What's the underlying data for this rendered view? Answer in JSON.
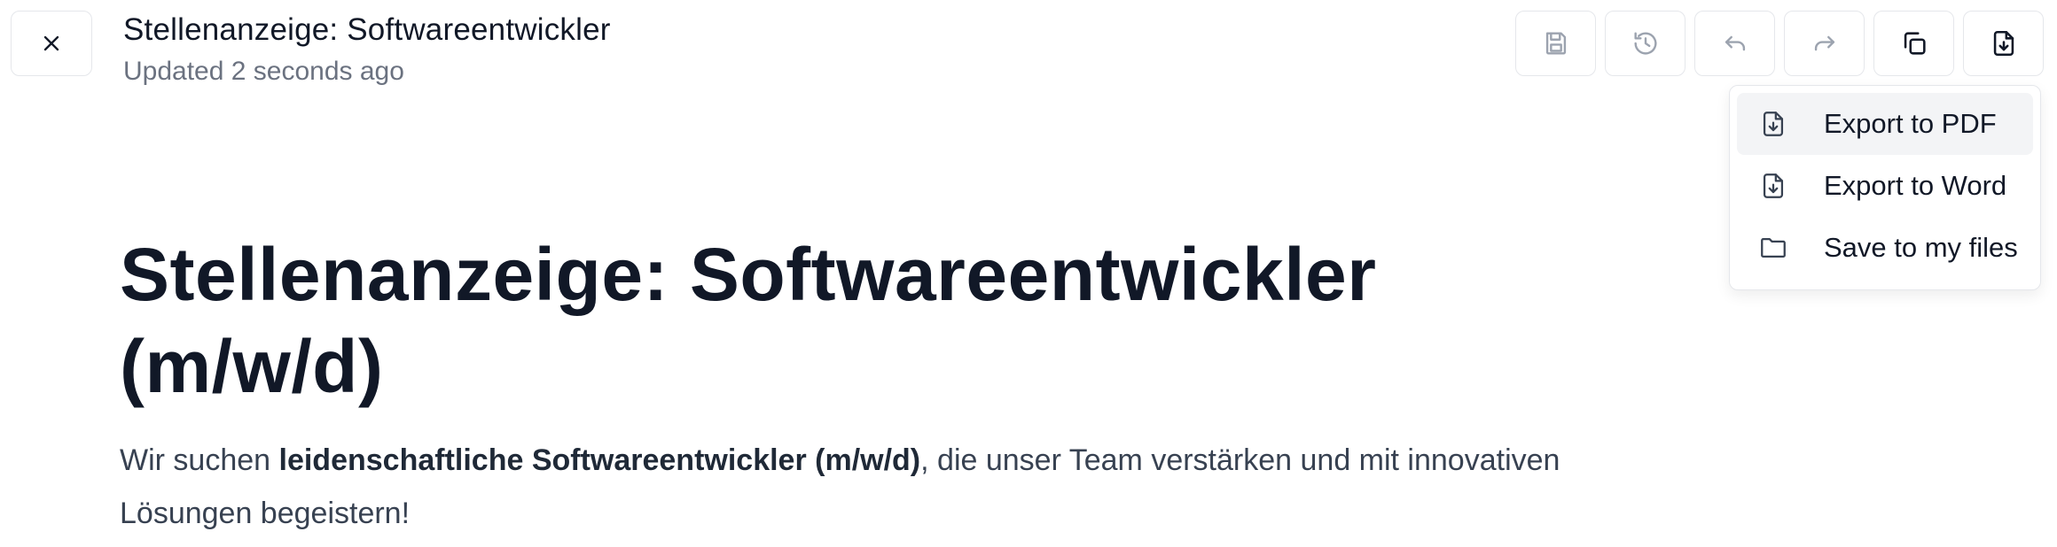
{
  "header": {
    "title": "Stellenanzeige: Softwareentwickler",
    "updated": "Updated 2 seconds ago"
  },
  "toolbar": {
    "buttons": [
      {
        "icon": "save-icon",
        "state": "disabled"
      },
      {
        "icon": "history-icon",
        "state": "disabled"
      },
      {
        "icon": "undo-icon",
        "state": "disabled"
      },
      {
        "icon": "redo-icon",
        "state": "disabled"
      },
      {
        "icon": "copy-icon",
        "state": "enabled"
      },
      {
        "icon": "export-icon",
        "state": "enabled"
      }
    ]
  },
  "export_menu": {
    "items": [
      {
        "label": "Export to PDF",
        "icon": "file-download-icon"
      },
      {
        "label": "Export to Word",
        "icon": "file-download-icon"
      },
      {
        "label": "Save to my files",
        "icon": "folder-icon"
      }
    ]
  },
  "document": {
    "heading": "Stellenanzeige: Softwareentwickler (m/w/d)",
    "paragraph": {
      "before": "Wir suchen ",
      "bold": "leidenschaftliche Softwareentwickler (m/w/d)",
      "after": ", die unser Team verstärken und mit innovativen Lösungen begeistern!"
    }
  },
  "colors": {
    "text_primary": "#111827",
    "text_muted": "#6b7280",
    "border": "#e5e7eb",
    "menu_highlight": "#f3f4f6",
    "icon_disabled": "#9ca3af"
  }
}
